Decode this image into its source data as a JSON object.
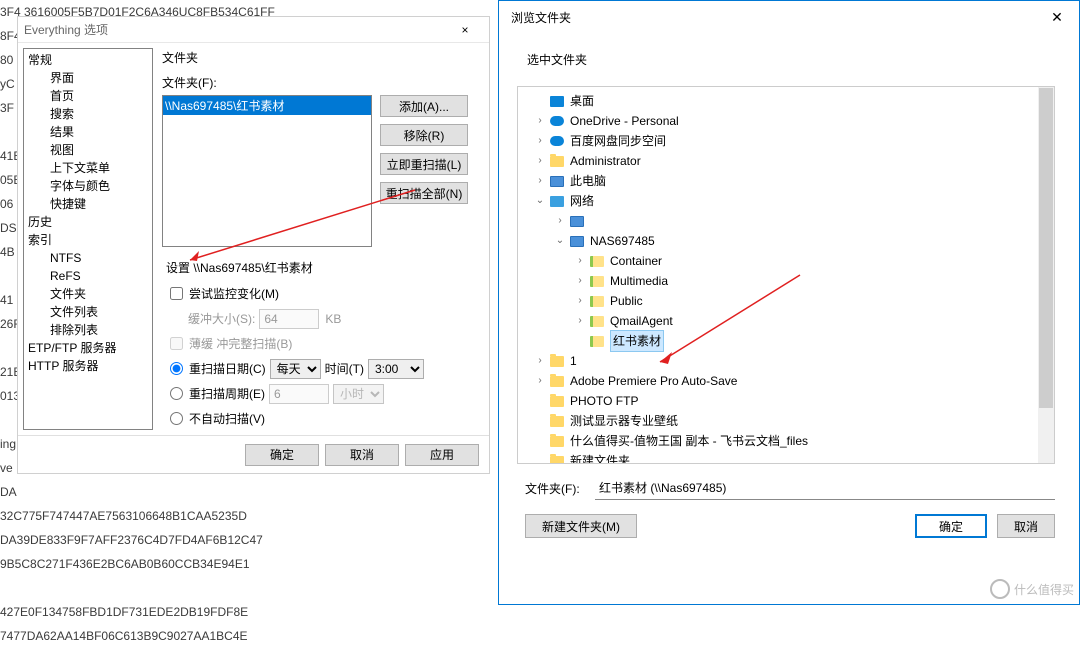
{
  "bg_lines": [
    "3F4 3616005F5B7D01F2C6A346UC8FB534C61FF",
    "8F4",
    "80",
    "yC",
    "3F",
    "",
    "41E",
    "05E",
    "06",
    "DS",
    "4B",
    "",
    "41 5",
    "26F",
    "",
    "21B",
    "013",
    "",
    "ing",
    "ve",
    "DA",
    "32C775F747447AE7563106648B1CAA5235D",
    "DA39DE833F9F7AFF2376C4D7FD4AF6B12C47",
    "9B5C8C271F436E2BC6AB0B60CCB34E94E1",
    "",
    "427E0F134758FBD1DF731EDE2DB19FDF8E",
    "7477DA62AA14BF06C613B9C9027AA1BC4E"
  ],
  "ev": {
    "title": "Everything 选项",
    "close": "×",
    "tree": [
      {
        "label": "常规",
        "lvl": 1
      },
      {
        "label": "界面",
        "lvl": 2
      },
      {
        "label": "首页",
        "lvl": 2
      },
      {
        "label": "搜索",
        "lvl": 2
      },
      {
        "label": "结果",
        "lvl": 2
      },
      {
        "label": "视图",
        "lvl": 2
      },
      {
        "label": "上下文菜单",
        "lvl": 2
      },
      {
        "label": "字体与颜色",
        "lvl": 2
      },
      {
        "label": "快捷键",
        "lvl": 2
      },
      {
        "label": "历史",
        "lvl": 1
      },
      {
        "label": "索引",
        "lvl": 1
      },
      {
        "label": "NTFS",
        "lvl": 2
      },
      {
        "label": "ReFS",
        "lvl": 2
      },
      {
        "label": "文件夹",
        "lvl": 2
      },
      {
        "label": "文件列表",
        "lvl": 2
      },
      {
        "label": "排除列表",
        "lvl": 2
      },
      {
        "label": "ETP/FTP 服务器",
        "lvl": 1
      },
      {
        "label": "HTTP 服务器",
        "lvl": 1
      }
    ],
    "folder_label": "文件夹",
    "folder_field": "文件夹(F):",
    "folder_selected": "\\\\Nas697485\\红书素材",
    "btn_add": "添加(A)...",
    "btn_remove": "移除(R)",
    "btn_rescan_now": "立即重扫描(L)",
    "btn_rescan_all": "重扫描全部(N)",
    "settings_header": "设置 \\\\Nas697485\\红书素材",
    "chk_monitor": "尝试监控变化(M)",
    "buf_label": "缓冲大小(S):",
    "buf_value": "64",
    "buf_unit": "KB",
    "chk_dilute": "薄缓 冲完整扫描(B)",
    "opt_date": "重扫描日期(C)",
    "date_dropdown": "每天",
    "time_label": "时间(T)",
    "time_value": "3:00",
    "opt_cycle": "重扫描周期(E)",
    "cycle_value": "6",
    "cycle_unit": "小时",
    "opt_noauto": "不自动扫描(V)",
    "ok": "确定",
    "cancel": "取消",
    "apply": "应用"
  },
  "br": {
    "title": "浏览文件夹",
    "close": "✕",
    "prompt": "选中文件夹",
    "tree": [
      {
        "pad": 14,
        "chev": "",
        "icon": "desktop",
        "label": "桌面"
      },
      {
        "pad": 14,
        "chev": "›",
        "icon": "cloud",
        "label": "OneDrive - Personal"
      },
      {
        "pad": 14,
        "chev": "›",
        "icon": "cloud",
        "label": "百度网盘同步空间"
      },
      {
        "pad": 14,
        "chev": "›",
        "icon": "folder",
        "label": "Administrator"
      },
      {
        "pad": 14,
        "chev": "›",
        "icon": "pc",
        "label": "此电脑"
      },
      {
        "pad": 14,
        "chev": "⌄",
        "icon": "net",
        "label": "网络"
      },
      {
        "pad": 34,
        "chev": "›",
        "icon": "pc",
        "label": ""
      },
      {
        "pad": 34,
        "chev": "⌄",
        "icon": "pc",
        "label": "NAS697485"
      },
      {
        "pad": 54,
        "chev": "›",
        "icon": "folder-open",
        "label": "Container"
      },
      {
        "pad": 54,
        "chev": "›",
        "icon": "folder-open",
        "label": "Multimedia"
      },
      {
        "pad": 54,
        "chev": "›",
        "icon": "folder-open",
        "label": "Public"
      },
      {
        "pad": 54,
        "chev": "›",
        "icon": "folder-open",
        "label": "QmailAgent"
      },
      {
        "pad": 54,
        "chev": "",
        "icon": "folder-open",
        "label": "红书素材",
        "sel": true
      },
      {
        "pad": 14,
        "chev": "›",
        "icon": "folder",
        "label": "1"
      },
      {
        "pad": 14,
        "chev": "›",
        "icon": "folder",
        "label": "Adobe Premiere Pro Auto-Save"
      },
      {
        "pad": 14,
        "chev": "",
        "icon": "folder",
        "label": "PHOTO FTP"
      },
      {
        "pad": 14,
        "chev": "",
        "icon": "folder",
        "label": "测试显示器专业壁纸"
      },
      {
        "pad": 14,
        "chev": "",
        "icon": "folder",
        "label": "什么值得买-值物王国 副本 - 飞书云文档_files"
      },
      {
        "pad": 14,
        "chev": "",
        "icon": "folder",
        "label": "新建文件夹"
      }
    ],
    "folder_field": "文件夹(F):",
    "folder_value": "红书素材 (\\\\Nas697485)",
    "new_folder": "新建文件夹(M)",
    "ok": "确定",
    "cancel": "取消"
  },
  "watermark": "什么值得买"
}
